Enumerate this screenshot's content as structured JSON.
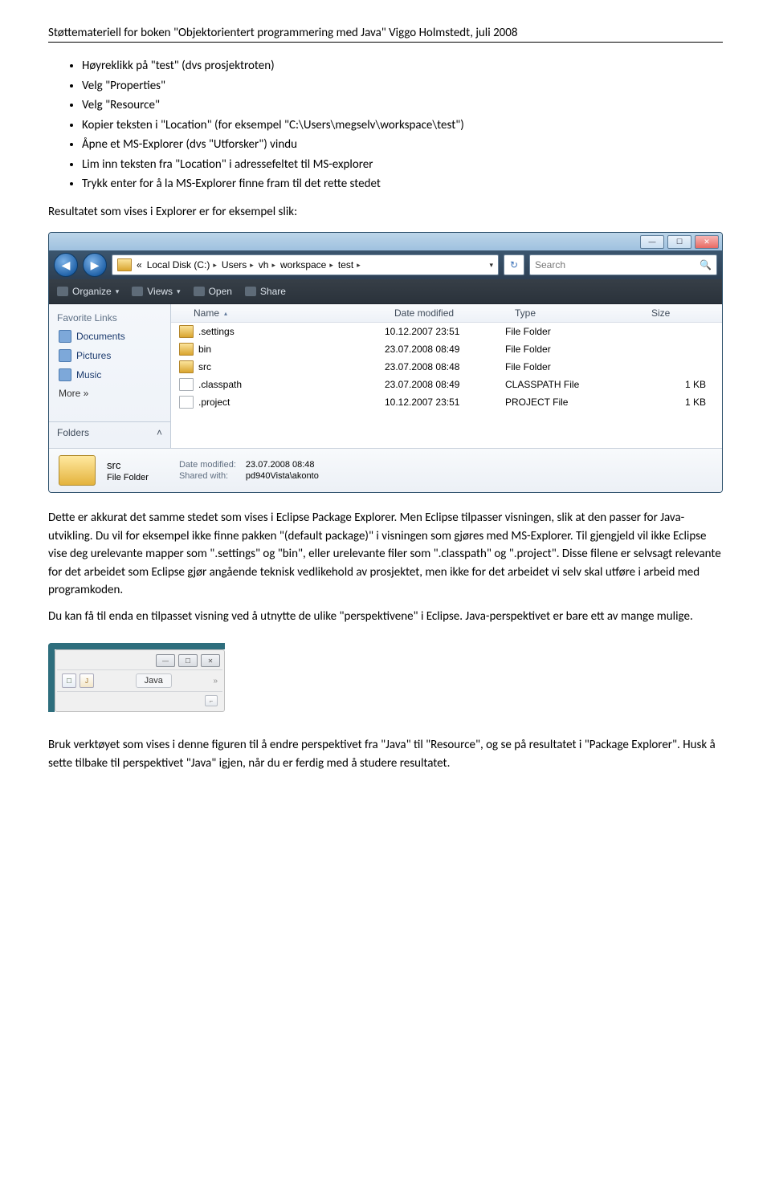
{
  "header": "Støttemateriell for boken \"Objektorientert programmering med Java\"   Viggo Holmstedt, juli 2008",
  "bullets": [
    "Høyreklikk på \"test\" (dvs prosjektroten)",
    "Velg \"Properties\"",
    "Velg \"Resource\"",
    "Kopier teksten i \"Location\" (for eksempel \"C:\\Users\\megselv\\workspace\\test\")",
    "Åpne et MS-Explorer (dvs \"Utforsker\") vindu",
    "Lim inn teksten fra \"Location\" i adressefeltet til MS-explorer",
    "Trykk enter for å la MS-Explorer finne fram til det rette stedet"
  ],
  "para1": "Resultatet som vises i Explorer er for eksempel slik:",
  "explorer": {
    "breadcrumb": [
      "Local Disk (C:)",
      "Users",
      "vh",
      "workspace",
      "test"
    ],
    "bc_prefix": "«",
    "search_placeholder": "Search",
    "toolbar": {
      "organize": "Organize",
      "views": "Views",
      "open": "Open",
      "share": "Share"
    },
    "sidebar": {
      "fav_header": "Favorite Links",
      "items": [
        "Documents",
        "Pictures",
        "Music",
        "More »"
      ],
      "folders_header": "Folders"
    },
    "cols": {
      "name": "Name",
      "dm": "Date modified",
      "type": "Type",
      "size": "Size"
    },
    "files": [
      {
        "icon": "folder",
        "name": ".settings",
        "dm": "10.12.2007 23:51",
        "type": "File Folder",
        "size": ""
      },
      {
        "icon": "folder",
        "name": "bin",
        "dm": "23.07.2008 08:49",
        "type": "File Folder",
        "size": ""
      },
      {
        "icon": "folder",
        "name": "src",
        "dm": "23.07.2008 08:48",
        "type": "File Folder",
        "size": ""
      },
      {
        "icon": "doc",
        "name": ".classpath",
        "dm": "23.07.2008 08:49",
        "type": "CLASSPATH File",
        "size": "1 KB"
      },
      {
        "icon": "doc",
        "name": ".project",
        "dm": "10.12.2007 23:51",
        "type": "PROJECT File",
        "size": "1 KB"
      }
    ],
    "details": {
      "name": "src",
      "dm_label": "Date modified:",
      "dm": "23.07.2008 08:48",
      "type": "File Folder",
      "shared_label": "Shared with:",
      "shared": "pd940Vista\\akonto"
    }
  },
  "para2": "Dette er akkurat det samme stedet som vises i Eclipse Package Explorer. Men Eclipse tilpasser visningen, slik at den passer for Java-utvikling. Du vil for eksempel ikke finne pakken \"(default package)\" i visningen som gjøres med MS-Explorer. Til gjengjeld vil ikke Eclipse vise deg urelevante mapper som \".settings\" og \"bin\", eller urelevante filer som \".classpath\" og \".project\". Disse filene er selvsagt relevante for det arbeidet som Eclipse gjør angående teknisk vedlikehold av prosjektet, men ikke for det arbeidet vi selv skal utføre i arbeid med programkoden.",
  "para3": "Du kan få til enda en tilpasset visning ved å utnytte de ulike \"perspektivene\" i Eclipse. Java-perspektivet er bare ett av mange mulige.",
  "mini": {
    "ico1": "☐",
    "ico2": "J",
    "java_tab": "Java"
  },
  "para4": "Bruk verktøyet som vises i denne figuren til å endre perspektivet fra \"Java\" til \"Resource\", og se på resultatet i \"Package Explorer\". Husk å sette tilbake til perspektivet \"Java\" igjen, når du er ferdig med å studere resultatet."
}
